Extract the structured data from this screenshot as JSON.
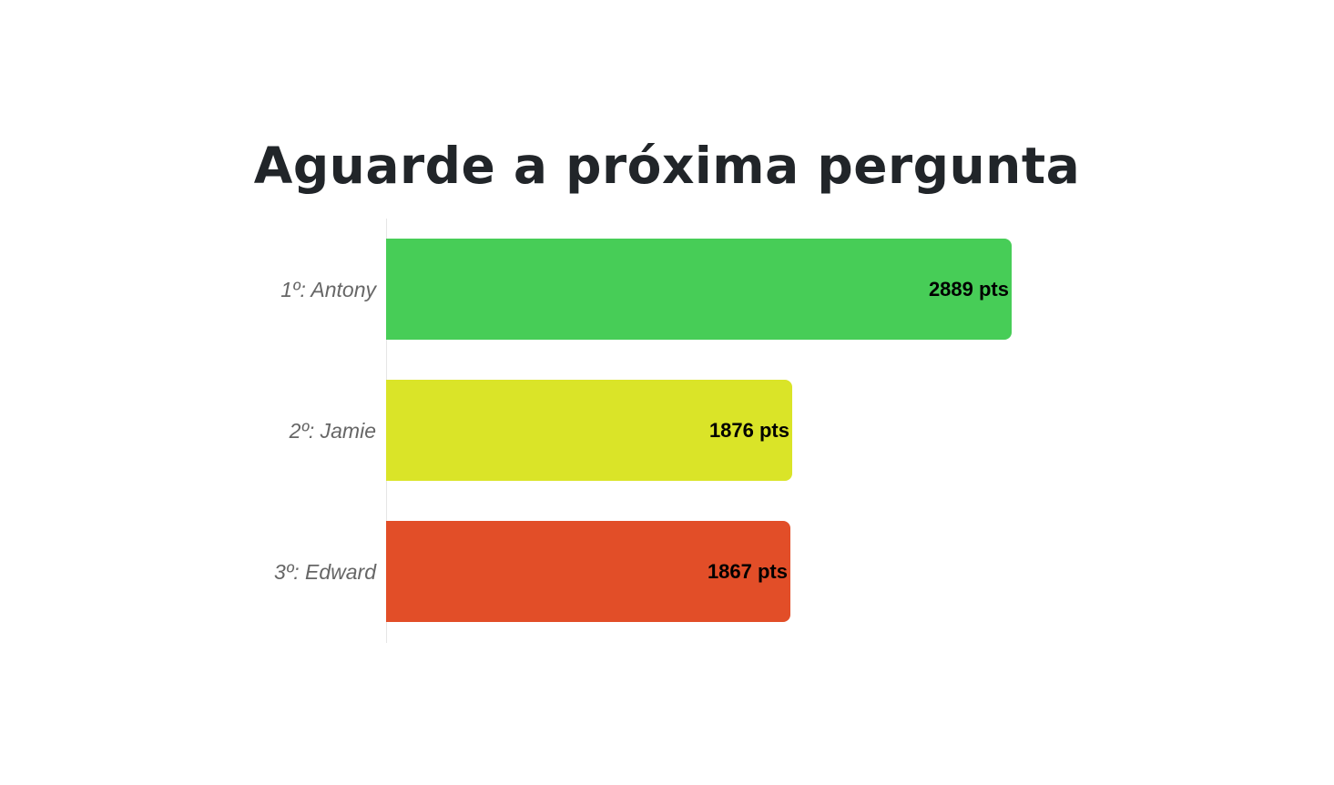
{
  "header": {
    "title": "Aguarde a próxima pergunta"
  },
  "chart_data": {
    "type": "bar",
    "orientation": "horizontal",
    "categories": [
      "1º: Antony",
      "2º: Jamie",
      "3º: Edward"
    ],
    "values": [
      2889,
      1876,
      1867
    ],
    "value_labels": [
      "2889 pts",
      "1876 pts",
      "1867 pts"
    ],
    "colors": [
      "#47cd57",
      "#dae428",
      "#e24e28"
    ],
    "xlim": [
      0,
      2889
    ],
    "grid": false,
    "legend": "none"
  }
}
